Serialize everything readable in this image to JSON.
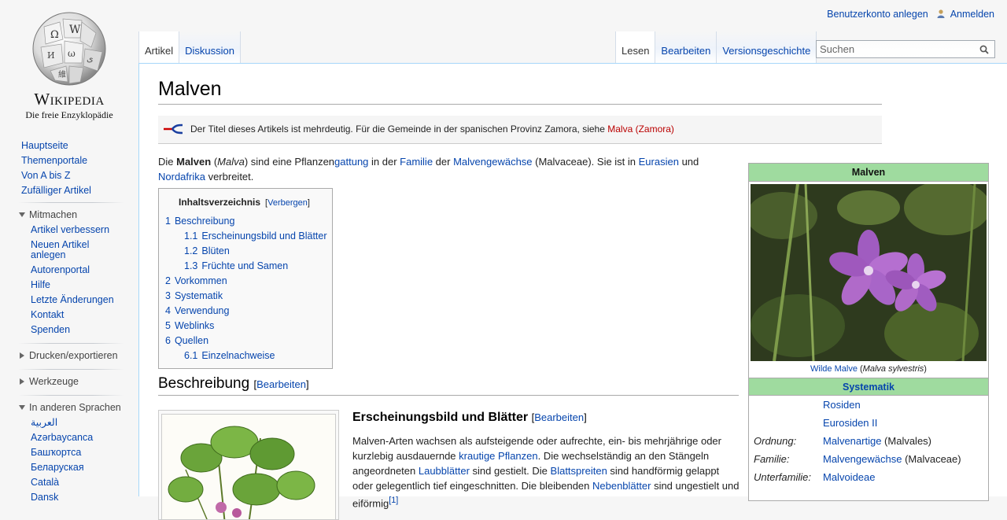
{
  "logo": {
    "wordmark": "Wikipedia",
    "tagline": "Die freie Enzyklopädie"
  },
  "personal": {
    "create_account": "Benutzerkonto anlegen",
    "login": "Anmelden"
  },
  "nav": {
    "main": [
      "Hauptseite",
      "Themenportale",
      "Von A bis Z",
      "Zufälliger Artikel"
    ],
    "mitmachen": {
      "heading": "Mitmachen",
      "items": [
        "Artikel verbessern",
        "Neuen Artikel anlegen",
        "Autorenportal",
        "Hilfe",
        "Letzte Änderungen",
        "Kontakt",
        "Spenden"
      ]
    },
    "print": "Drucken/exportieren",
    "tools": "Werkzeuge",
    "languages": {
      "heading": "In anderen Sprachen",
      "items": [
        "العربية",
        "Azərbaycanca",
        "Башҡортса",
        "Беларуская",
        "Català",
        "Dansk"
      ]
    }
  },
  "tabs": {
    "left": [
      "Artikel",
      "Diskussion"
    ],
    "right": [
      "Lesen",
      "Bearbeiten",
      "Versionsgeschichte"
    ]
  },
  "search": {
    "placeholder": "Suchen"
  },
  "article": {
    "title": "Malven",
    "hatnote": {
      "text": "Der Titel dieses Artikels ist mehrdeutig. Für die Gemeinde in der spanischen Provinz Zamora, siehe ",
      "link": "Malva (Zamora)"
    },
    "lead": {
      "t1": "Die ",
      "b1": "Malven",
      "t2": " (",
      "i1": "Malva",
      "t3": ") sind eine Pflanzen",
      "l1": "gattung",
      "t4": " in der ",
      "l2": "Familie",
      "t5": " der ",
      "l3": "Malvengewächse",
      "t6": " (Malvaceae). Sie ist in ",
      "l4": "Eurasien",
      "t7": " und ",
      "l5": "Nordafrika",
      "t8": " verbreitet."
    },
    "toc": {
      "title": "Inhaltsverzeichnis",
      "toggle": "Verbergen",
      "items": [
        {
          "num": "1",
          "text": "Beschreibung"
        },
        {
          "num": "1.1",
          "text": "Erscheinungsbild und Blätter"
        },
        {
          "num": "1.2",
          "text": "Blüten"
        },
        {
          "num": "1.3",
          "text": "Früchte und Samen"
        },
        {
          "num": "2",
          "text": "Vorkommen"
        },
        {
          "num": "3",
          "text": "Systematik"
        },
        {
          "num": "4",
          "text": "Verwendung"
        },
        {
          "num": "5",
          "text": "Weblinks"
        },
        {
          "num": "6",
          "text": "Quellen"
        },
        {
          "num": "6.1",
          "text": "Einzelnachweise"
        }
      ]
    },
    "section1": {
      "heading": "Beschreibung",
      "edit": "Bearbeiten"
    },
    "subsection": {
      "heading": "Erscheinungsbild und Blätter",
      "edit": "Bearbeiten"
    },
    "paragraph": {
      "t1": "Malven-Arten wachsen als aufsteigende oder aufrechte, ein- bis mehrjährige oder kurzlebig ausdauernde ",
      "l1": "krautige Pflanzen",
      "t2": ". Die wechselständig an den Stängeln angeordneten ",
      "l2": "Laubblätter",
      "t3": " sind gestielt. Die ",
      "l3": "Blattspreiten",
      "t4": " sind handförmig gelappt oder gelegentlich tief eingeschnitten. Die bleibenden ",
      "l4": "Nebenblätter",
      "t5": " sind ungestielt und",
      "t6": " eiförmig",
      "ref": "[1]"
    }
  },
  "infobox": {
    "title": "Malven",
    "caption_link": "Wilde Malve",
    "caption_italic": "Malva sylvestris",
    "systematik": "Systematik",
    "rows": [
      {
        "k": "",
        "v": "Rosiden",
        "extra": ""
      },
      {
        "k": "",
        "v": "Eurosiden II",
        "extra": ""
      },
      {
        "k": "Ordnung:",
        "v": "Malvenartige",
        "extra": " (Malvales)"
      },
      {
        "k": "Familie:",
        "v": "Malvengewächse",
        "extra": " (Malvaceae)"
      },
      {
        "k": "Unterfamilie:",
        "v": "Malvoideae",
        "extra": ""
      }
    ]
  },
  "colors": {
    "link": "#0645ad",
    "redlink": "#ba0000",
    "infobox_header": "#9fdb9f"
  }
}
